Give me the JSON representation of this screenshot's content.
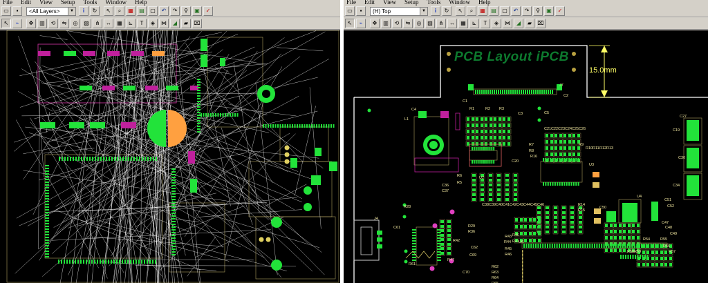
{
  "left_window": {
    "menu": [
      "File",
      "Edit",
      "View",
      "Setup",
      "Tools",
      "Window",
      "Help"
    ],
    "layer_select": "<All Layers>"
  },
  "right_window": {
    "menu": [
      "File",
      "Edit",
      "View",
      "Setup",
      "Tools",
      "Window",
      "Help"
    ],
    "layer_select": "(H) Top",
    "board_title": "PCB Layout iPCB",
    "dimension_label": "15.0mm",
    "refdes": [
      "J7",
      "C2",
      "C1",
      "C4",
      "L1",
      "R1",
      "R2",
      "R3",
      "C5",
      "C3",
      "C21",
      "C22",
      "C23",
      "C24",
      "C25",
      "C26",
      "R7",
      "R8",
      "R9",
      "R10",
      "R11",
      "R12",
      "R13",
      "C20",
      "R16",
      "U2",
      "U3",
      "R6",
      "R5",
      "C27",
      "C19",
      "C30",
      "C34",
      "U4",
      "C50",
      "C51",
      "C52",
      "C47",
      "C48",
      "C49",
      "R28",
      "J4",
      "C61",
      "C62",
      "C69",
      "C70",
      "R29",
      "R36",
      "R42",
      "R47",
      "R54",
      "R55",
      "R56",
      "R57",
      "R61",
      "R62",
      "R63",
      "R64",
      "R65",
      "R40",
      "R41",
      "R43",
      "R44",
      "R45",
      "R46",
      "C36",
      "C37",
      "C38",
      "C39",
      "C40",
      "C41",
      "C42",
      "C43",
      "C44",
      "C45",
      "C46",
      "R14",
      "R15",
      "U6",
      "R58",
      "R59"
    ]
  },
  "colors": {
    "canvas": "#000000",
    "pad_green": "#22e33a",
    "silkscreen": "#f2e8a0",
    "ratsnest": "#ffffff",
    "keepout_magenta": "#c0209c",
    "pad_orange": "#ffa040",
    "board_outline": "#ffffff",
    "dimension": "#ffff66",
    "title_green": "#0d7a2e"
  }
}
